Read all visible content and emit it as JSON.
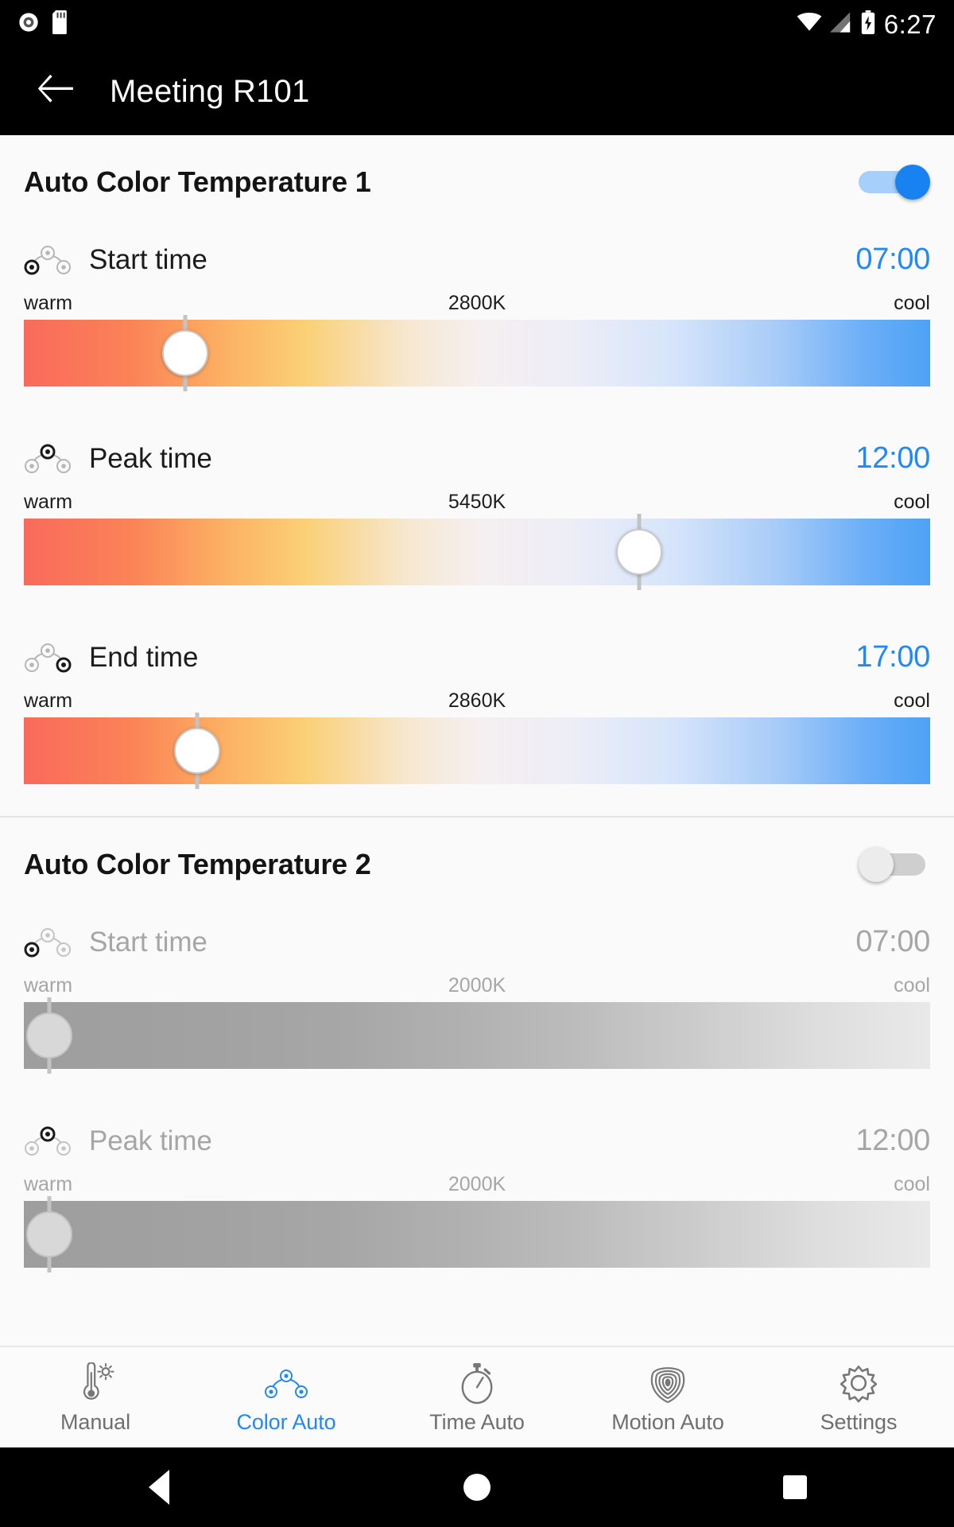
{
  "statusbar": {
    "time": "6:27",
    "icons": [
      "record-icon",
      "sd-card-icon",
      "wifi-icon",
      "cellular-signal-icon",
      "battery-charging-icon"
    ]
  },
  "appbar": {
    "back_icon": "arrow-left-icon",
    "title": "Meeting R101"
  },
  "groups": [
    {
      "title": "Auto Color Temperature 1",
      "enabled": true,
      "toggle_state": "on",
      "rows": [
        {
          "icon": "sun-arc-start-icon",
          "label": "Start time",
          "time": "07:00",
          "warm_label": "warm",
          "cool_label": "cool",
          "kelvin": "2800K",
          "thumb_pct": 17.8
        },
        {
          "icon": "sun-arc-peak-icon",
          "label": "Peak time",
          "time": "12:00",
          "warm_label": "warm",
          "cool_label": "cool",
          "kelvin": "5450K",
          "thumb_pct": 67.9
        },
        {
          "icon": "sun-arc-end-icon",
          "label": "End time",
          "time": "17:00",
          "warm_label": "warm",
          "cool_label": "cool",
          "kelvin": "2860K",
          "thumb_pct": 19.1
        }
      ]
    },
    {
      "title": "Auto Color Temperature 2",
      "enabled": false,
      "toggle_state": "off",
      "rows": [
        {
          "icon": "sun-arc-start-icon",
          "label": "Start time",
          "time": "07:00",
          "warm_label": "warm",
          "cool_label": "cool",
          "kelvin": "2000K",
          "thumb_pct": 2.8
        },
        {
          "icon": "sun-arc-peak-icon",
          "label": "Peak time",
          "time": "12:00",
          "warm_label": "warm",
          "cool_label": "cool",
          "kelvin": "2000K",
          "thumb_pct": 2.8
        }
      ]
    }
  ],
  "tabs": [
    {
      "label": "Manual",
      "icon": "thermometer-sun-icon",
      "active": false
    },
    {
      "label": "Color Auto",
      "icon": "sun-arc-icon",
      "active": true
    },
    {
      "label": "Time Auto",
      "icon": "stopwatch-icon",
      "active": false
    },
    {
      "label": "Motion Auto",
      "icon": "motion-radar-icon",
      "active": false
    },
    {
      "label": "Settings",
      "icon": "gear-icon",
      "active": false
    }
  ],
  "navbar": {
    "back": "triangle-back-icon",
    "home": "circle-home-icon",
    "recents": "square-recents-icon"
  },
  "colors": {
    "accent": "#2089f5",
    "toggle_on": "#1782f0",
    "appbar_bg": "#000000",
    "page_bg": "#fafafa",
    "disabled_text": "#a6a6a6"
  }
}
